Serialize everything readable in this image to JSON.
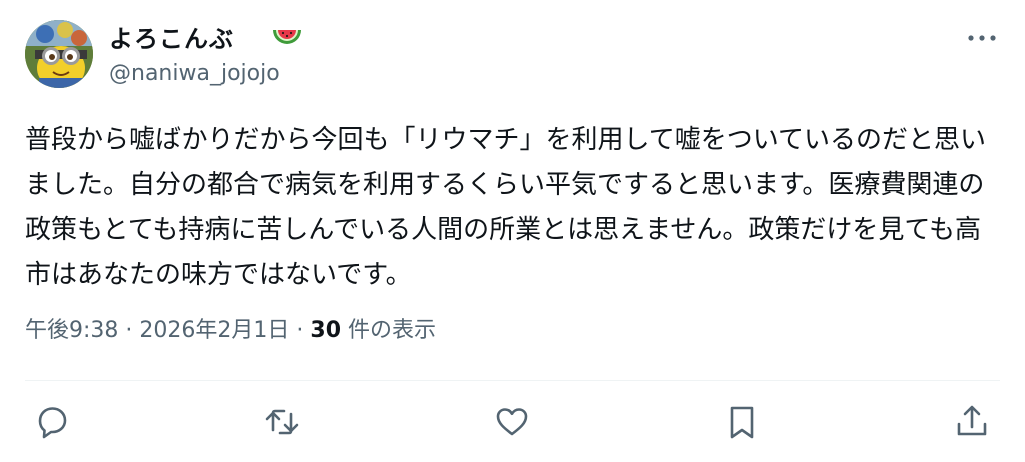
{
  "user": {
    "display_name": "よろこんぶ",
    "name_emoji": "watermelon-emoji",
    "handle": "@naniwa_jojojo"
  },
  "tweet": {
    "text": "普段から嘘ばかりだから今回も「リウマチ」を利用して嘘をついているのだと思いました。自分の都合で病気を利用するくらい平気ですると思います。医療費関連の政策もとても持病に苦しんでいる人間の所業とは思えません。政策だけを見ても高市はあなたの味方ではないです。"
  },
  "meta": {
    "time": "午後9:38",
    "separator": "·",
    "date": "2026年2月1日",
    "views_count": "30",
    "views_label": "件の表示"
  },
  "icons": {
    "more": "more-icon",
    "reply": "reply-icon",
    "retweet": "retweet-icon",
    "like": "like-icon",
    "bookmark": "bookmark-icon",
    "share": "share-icon"
  },
  "colors": {
    "text": "#0f1419",
    "secondary": "#536471",
    "divider": "#eff3f4"
  }
}
